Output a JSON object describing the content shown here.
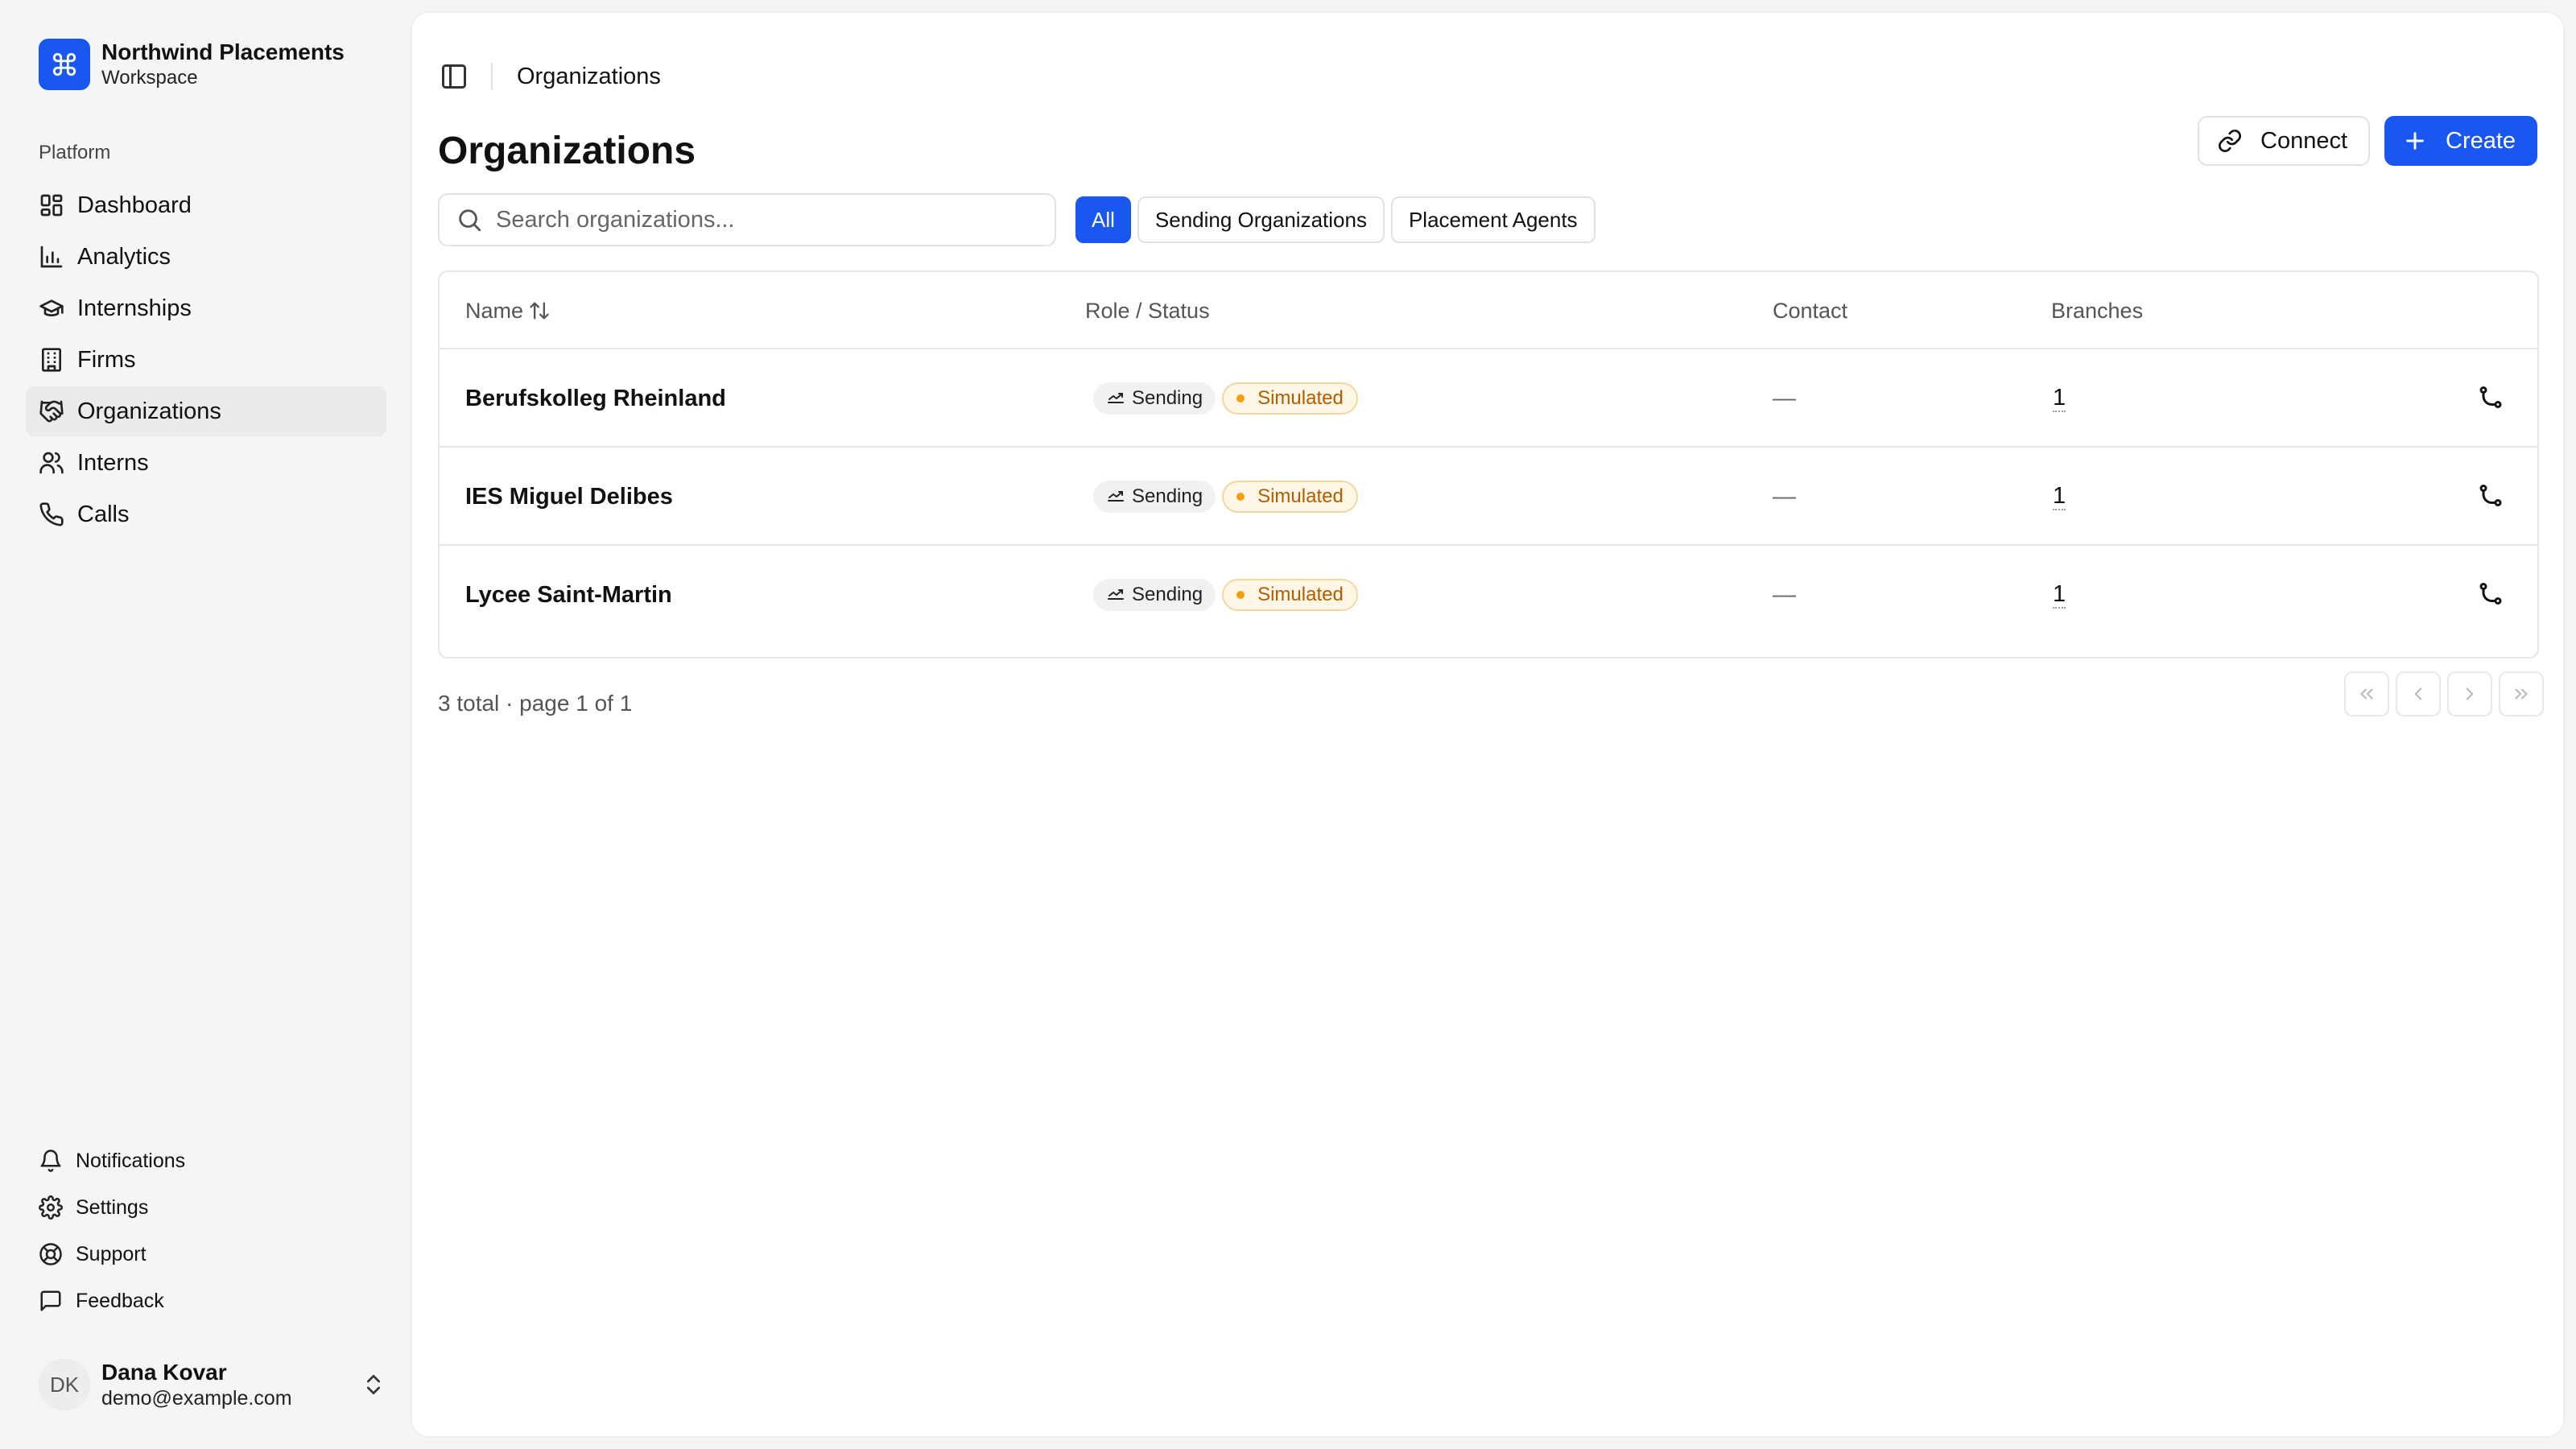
{
  "brand": {
    "name": "Northwind Placements",
    "sub": "Workspace"
  },
  "sidebar": {
    "group_label": "Platform",
    "items": [
      {
        "label": "Dashboard",
        "icon": "dashboard-icon"
      },
      {
        "label": "Analytics",
        "icon": "bar-chart-icon"
      },
      {
        "label": "Internships",
        "icon": "graduation-cap-icon"
      },
      {
        "label": "Firms",
        "icon": "building-icon"
      },
      {
        "label": "Organizations",
        "icon": "handshake-icon",
        "active": true
      },
      {
        "label": "Interns",
        "icon": "users-icon"
      },
      {
        "label": "Calls",
        "icon": "phone-icon"
      }
    ],
    "bottom_items": [
      {
        "label": "Notifications",
        "icon": "bell-icon"
      },
      {
        "label": "Settings",
        "icon": "gear-icon"
      },
      {
        "label": "Support",
        "icon": "life-buoy-icon"
      },
      {
        "label": "Feedback",
        "icon": "message-square-icon"
      }
    ]
  },
  "user": {
    "initials": "DK",
    "name": "Dana Kovar",
    "email": "demo@example.com"
  },
  "header": {
    "breadcrumb": "Organizations",
    "title": "Organizations"
  },
  "actions": {
    "connect_label": "Connect",
    "create_label": "Create"
  },
  "search": {
    "placeholder": "Search organizations...",
    "value": ""
  },
  "filters": [
    {
      "label": "All",
      "active": true
    },
    {
      "label": "Sending Organizations",
      "active": false
    },
    {
      "label": "Placement Agents",
      "active": false
    }
  ],
  "table": {
    "columns": {
      "name": "Name",
      "role_status": "Role / Status",
      "contact": "Contact",
      "branches": "Branches"
    },
    "rows": [
      {
        "name": "Berufskolleg Rheinland",
        "role": "Sending",
        "status": "Simulated",
        "contact": "—",
        "branches": "1"
      },
      {
        "name": "IES Miguel Delibes",
        "role": "Sending",
        "status": "Simulated",
        "contact": "—",
        "branches": "1"
      },
      {
        "name": "Lycee Saint-Martin",
        "role": "Sending",
        "status": "Simulated",
        "contact": "—",
        "branches": "1"
      }
    ]
  },
  "pagination": {
    "summary": "3 total · page 1 of 1"
  },
  "colors": {
    "accent": "#1a56f0",
    "simulated_text": "#b35c00",
    "simulated_dot": "#f59e0b"
  }
}
